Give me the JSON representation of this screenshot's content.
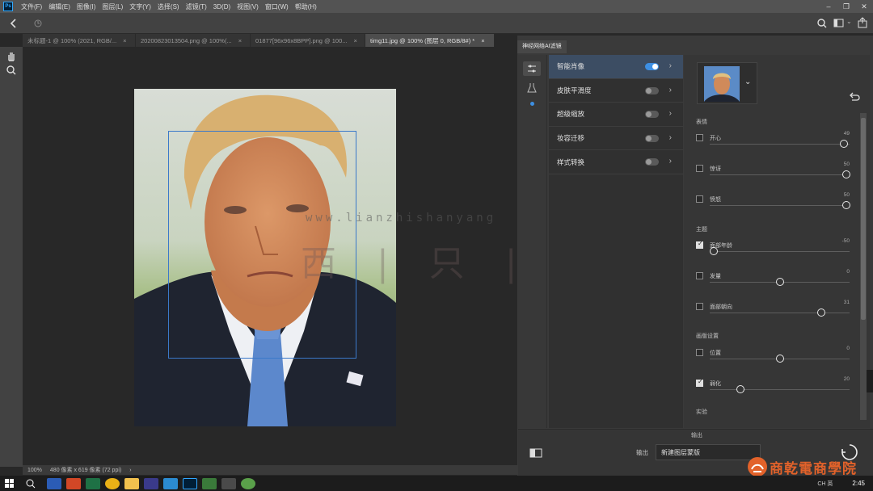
{
  "app": {
    "icon_text": "Ps",
    "accent": "#31a8ff"
  },
  "menu": [
    "文件(F)",
    "编辑(E)",
    "图像(I)",
    "图层(L)",
    "文字(Y)",
    "选择(S)",
    "滤镜(T)",
    "3D(D)",
    "视图(V)",
    "窗口(W)",
    "帮助(H)"
  ],
  "tabs": [
    {
      "label": "未标题-1 @ 100% (2021, RGB/...",
      "close": "×",
      "active": false
    },
    {
      "label": "20200823013504.png @ 100%(...",
      "close": "×",
      "active": false
    },
    {
      "label": "01877[96x96x8BPP].png @ 100...",
      "close": "×",
      "active": false
    },
    {
      "label": "timg11.jpg @ 100% (图层 0, RGB/8#) *",
      "close": "×",
      "active": true
    }
  ],
  "status": {
    "zoom": "100%",
    "doc_size": "480 像素 x 619 像素 (72 ppi)",
    "arrow": "›"
  },
  "watermark": {
    "url": "www.lianzhishanyang",
    "cn": "西 | 只 | 山 | 羊"
  },
  "neural_panel": {
    "title": "神经网络AI滤镜",
    "filters": [
      {
        "label": "智能肖像",
        "on": true,
        "active": true
      },
      {
        "label": "皮肤平滑度",
        "on": false,
        "active": false
      },
      {
        "label": "超级缩放",
        "on": false,
        "active": false
      },
      {
        "label": "妆容迁移",
        "on": false,
        "active": false
      },
      {
        "label": "样式转换",
        "on": false,
        "active": false
      }
    ],
    "sections": {
      "expression": "表情",
      "theme": "主题",
      "global": "画版设置",
      "experimental": "实验"
    },
    "sliders": [
      {
        "label": "开心",
        "value": "49",
        "checked": false,
        "pos": 0.98
      },
      {
        "label": "惊讶",
        "value": "50",
        "checked": false,
        "pos": 1.0
      },
      {
        "label": "愤怒",
        "value": "50",
        "checked": false,
        "pos": 1.0
      },
      {
        "label": "面部年龄",
        "value": "-50",
        "checked": true,
        "pos": 0.0
      },
      {
        "label": "发量",
        "value": "0",
        "checked": false,
        "pos": 0.5
      },
      {
        "label": "面部朝向",
        "value": "31",
        "checked": false,
        "pos": 0.81
      },
      {
        "label": "位置",
        "value": "0",
        "checked": false,
        "pos": 0.5
      },
      {
        "label": "弱化",
        "value": "20",
        "checked": true,
        "pos": 0.2
      }
    ],
    "output": {
      "label": "输出",
      "value": "新建图层蒙版",
      "header": "输出"
    }
  },
  "branding": {
    "text": "商乾電商學院",
    "color": "#e2622a"
  },
  "clock": "2:45",
  "tray_text": "CH 英"
}
